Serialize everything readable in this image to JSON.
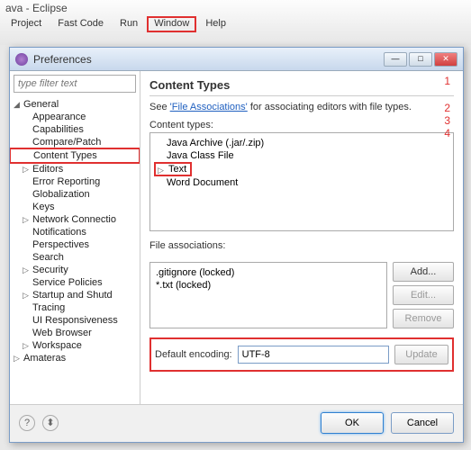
{
  "window": {
    "title": "ava - Eclipse"
  },
  "menubar": {
    "items": [
      "Project",
      "Fast Code",
      "Run",
      "Window",
      "Help"
    ],
    "highlighted": "Window"
  },
  "dialog": {
    "title": "Preferences",
    "filter_placeholder": "type filter text",
    "tree": {
      "root": "General",
      "items": [
        {
          "label": "Appearance",
          "exp": false
        },
        {
          "label": "Capabilities",
          "exp": false
        },
        {
          "label": "Compare/Patch",
          "exp": false
        },
        {
          "label": "Content Types",
          "exp": false,
          "hl": true
        },
        {
          "label": "Editors",
          "exp": true
        },
        {
          "label": "Error Reporting",
          "exp": false
        },
        {
          "label": "Globalization",
          "exp": false
        },
        {
          "label": "Keys",
          "exp": false
        },
        {
          "label": "Network Connectio",
          "exp": true
        },
        {
          "label": "Notifications",
          "exp": false
        },
        {
          "label": "Perspectives",
          "exp": false
        },
        {
          "label": "Search",
          "exp": false
        },
        {
          "label": "Security",
          "exp": true
        },
        {
          "label": "Service Policies",
          "exp": false
        },
        {
          "label": "Startup and Shutd",
          "exp": true
        },
        {
          "label": "Tracing",
          "exp": false
        },
        {
          "label": "UI Responsiveness",
          "exp": false
        },
        {
          "label": "Web Browser",
          "exp": false
        },
        {
          "label": "Workspace",
          "exp": true
        }
      ],
      "after_root": {
        "label": "Amateras",
        "exp": true
      }
    },
    "right": {
      "title": "Content Types",
      "desc_prefix": "See ",
      "desc_link": "'File Associations'",
      "desc_suffix": " for associating editors with file types.",
      "content_types_label": "Content types:",
      "content_types": [
        {
          "label": "Java Archive (.jar/.zip)"
        },
        {
          "label": "Java Class File"
        },
        {
          "label": "Text",
          "exp": true,
          "hl": true
        },
        {
          "label": "Word Document"
        }
      ],
      "file_assoc_label": "File associations:",
      "file_assoc": [
        ".gitignore (locked)",
        "*.txt (locked)"
      ],
      "buttons": {
        "add": "Add...",
        "edit": "Edit...",
        "remove": "Remove"
      },
      "encoding_label": "Default encoding:",
      "encoding_value": "UTF-8",
      "update": "Update"
    },
    "footer": {
      "ok": "OK",
      "cancel": "Cancel"
    }
  },
  "annotations": {
    "n1": "1",
    "n2": "2",
    "n3": "3",
    "n4": "4"
  }
}
